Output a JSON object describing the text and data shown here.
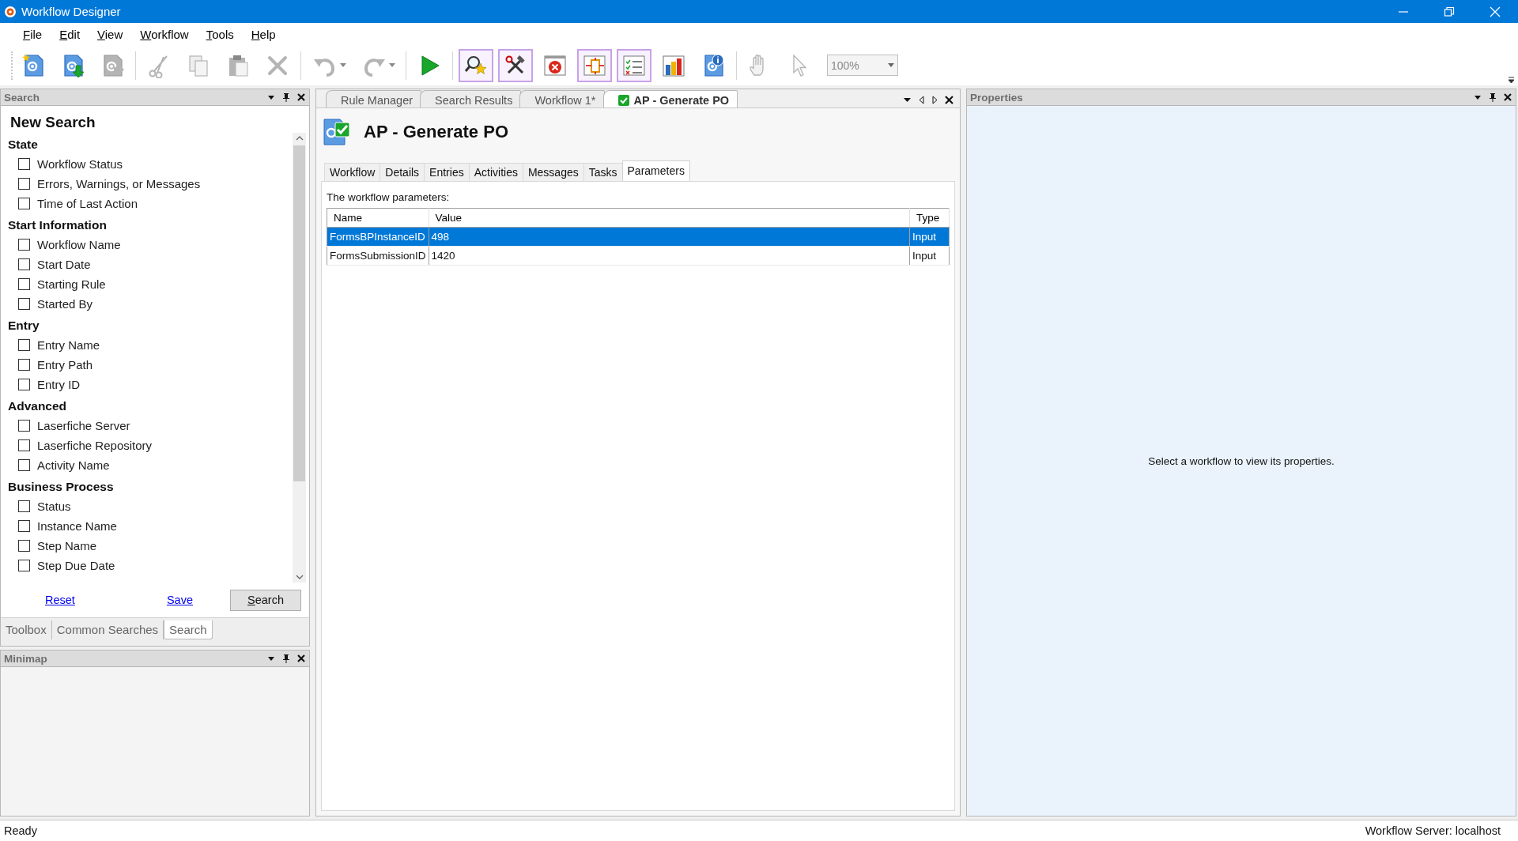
{
  "window": {
    "title": "Workflow Designer"
  },
  "menu": [
    {
      "label": "File"
    },
    {
      "label": "Edit"
    },
    {
      "label": "View"
    },
    {
      "label": "Workflow"
    },
    {
      "label": "Tools"
    },
    {
      "label": "Help"
    }
  ],
  "toolbar": {
    "buttons": [
      {
        "kind": "new",
        "disabled": false,
        "checked": false
      },
      {
        "kind": "import",
        "disabled": false,
        "checked": false
      },
      {
        "kind": "export",
        "disabled": true,
        "checked": false
      },
      {
        "kind": "separator"
      },
      {
        "kind": "cut",
        "disabled": true,
        "checked": false
      },
      {
        "kind": "copy",
        "disabled": true,
        "checked": false
      },
      {
        "kind": "paste",
        "disabled": true,
        "checked": false
      },
      {
        "kind": "delete",
        "disabled": true,
        "checked": false
      },
      {
        "kind": "separator"
      },
      {
        "kind": "undo",
        "disabled": true,
        "checked": false
      },
      {
        "kind": "redo",
        "disabled": true,
        "checked": false
      },
      {
        "kind": "separator"
      },
      {
        "kind": "run",
        "disabled": false,
        "checked": false
      },
      {
        "kind": "separator"
      },
      {
        "kind": "find",
        "disabled": false,
        "checked": true
      },
      {
        "kind": "tools",
        "disabled": false,
        "checked": true
      },
      {
        "kind": "stop",
        "disabled": false,
        "checked": false
      },
      {
        "kind": "toggle",
        "disabled": false,
        "checked": true
      },
      {
        "kind": "checklist",
        "disabled": false,
        "checked": true
      },
      {
        "kind": "chart",
        "disabled": false,
        "checked": false
      },
      {
        "kind": "info",
        "disabled": false,
        "checked": false
      },
      {
        "kind": "separator"
      },
      {
        "kind": "hand",
        "disabled": true,
        "checked": false
      },
      {
        "kind": "pointer",
        "disabled": true,
        "checked": false
      }
    ],
    "zoom": "100%"
  },
  "search_panel": {
    "title": "Search",
    "heading": "New Search",
    "groups": [
      {
        "label": "State",
        "items": [
          {
            "label": "Workflow Status",
            "checked": false
          },
          {
            "label": "Errors, Warnings, or Messages",
            "checked": false
          },
          {
            "label": "Time of Last Action",
            "checked": false
          }
        ]
      },
      {
        "label": "Start Information",
        "items": [
          {
            "label": "Workflow Name",
            "checked": false
          },
          {
            "label": "Start Date",
            "checked": false
          },
          {
            "label": "Starting Rule",
            "checked": false
          },
          {
            "label": "Started By",
            "checked": false
          }
        ]
      },
      {
        "label": "Entry",
        "items": [
          {
            "label": "Entry Name",
            "checked": false
          },
          {
            "label": "Entry Path",
            "checked": false
          },
          {
            "label": "Entry ID",
            "checked": false
          }
        ]
      },
      {
        "label": "Advanced",
        "items": [
          {
            "label": "Laserfiche Server",
            "checked": false
          },
          {
            "label": "Laserfiche Repository",
            "checked": false
          },
          {
            "label": "Activity Name",
            "checked": false
          }
        ]
      },
      {
        "label": "Business Process",
        "items": [
          {
            "label": "Status",
            "checked": false
          },
          {
            "label": "Instance Name",
            "checked": false
          },
          {
            "label": "Step Name",
            "checked": false
          },
          {
            "label": "Step Due Date",
            "checked": false
          }
        ]
      }
    ],
    "links": [
      "Reset",
      "Save"
    ],
    "button": "Search",
    "tabs": [
      {
        "label": "Toolbox",
        "selected": false
      },
      {
        "label": "Common Searches",
        "selected": false
      },
      {
        "label": "Search",
        "selected": true
      }
    ]
  },
  "minimap": {
    "title": "Minimap"
  },
  "document": {
    "tabs": [
      {
        "label": "Rule Manager",
        "selected": false
      },
      {
        "label": "Search Results",
        "selected": false
      },
      {
        "label": "Workflow 1*",
        "selected": false
      },
      {
        "label": "AP - Generate PO",
        "selected": true
      }
    ],
    "title": "AP - Generate PO",
    "subtabs": [
      {
        "label": "Workflow",
        "selected": false
      },
      {
        "label": "Details",
        "selected": false
      },
      {
        "label": "Entries",
        "selected": false
      },
      {
        "label": "Activities",
        "selected": false
      },
      {
        "label": "Messages",
        "selected": false
      },
      {
        "label": "Tasks",
        "selected": false
      },
      {
        "label": "Parameters",
        "selected": true
      }
    ],
    "caption": "The workflow parameters:",
    "table": {
      "columns": [
        "Name",
        "Value",
        "Type"
      ],
      "rows": [
        {
          "cells": [
            "FormsBPInstanceID",
            "498",
            "Input"
          ],
          "selected": true
        },
        {
          "cells": [
            "FormsSubmissionID",
            "1420",
            "Input"
          ],
          "selected": false
        }
      ]
    }
  },
  "properties": {
    "title": "Properties",
    "message": "Select a workflow to view its properties."
  },
  "status_bar": {
    "left": "Ready",
    "right": "Workflow Server: localhost"
  }
}
